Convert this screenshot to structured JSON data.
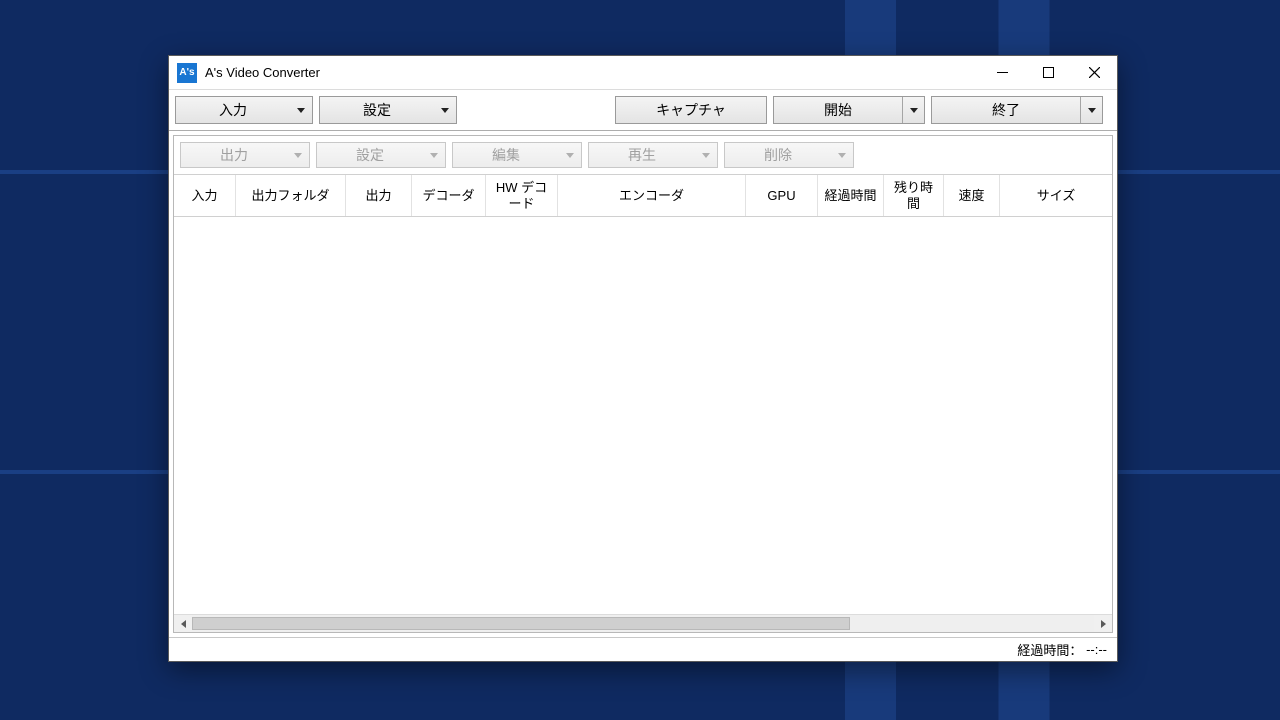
{
  "app": {
    "icon_text": "A's",
    "title": "A's Video Converter"
  },
  "toolbar": {
    "input": "入力",
    "settings": "設定",
    "capture": "キャプチャ",
    "start": "開始",
    "exit": "終了"
  },
  "subtoolbar": {
    "output": "出力",
    "settings": "設定",
    "edit": "編集",
    "play": "再生",
    "delete": "削除"
  },
  "columns": {
    "c0": "入力",
    "c1": "出力フォルダ",
    "c2": "出力",
    "c3": "デコーダ",
    "c4": "HW デコード",
    "c5": "エンコーダ",
    "c6": "GPU",
    "c7": "経過時間",
    "c8": "残り時間",
    "c9": "速度",
    "c10": "サイズ"
  },
  "status": {
    "elapsed_label": "経過時間：",
    "elapsed_value": "--:--"
  }
}
